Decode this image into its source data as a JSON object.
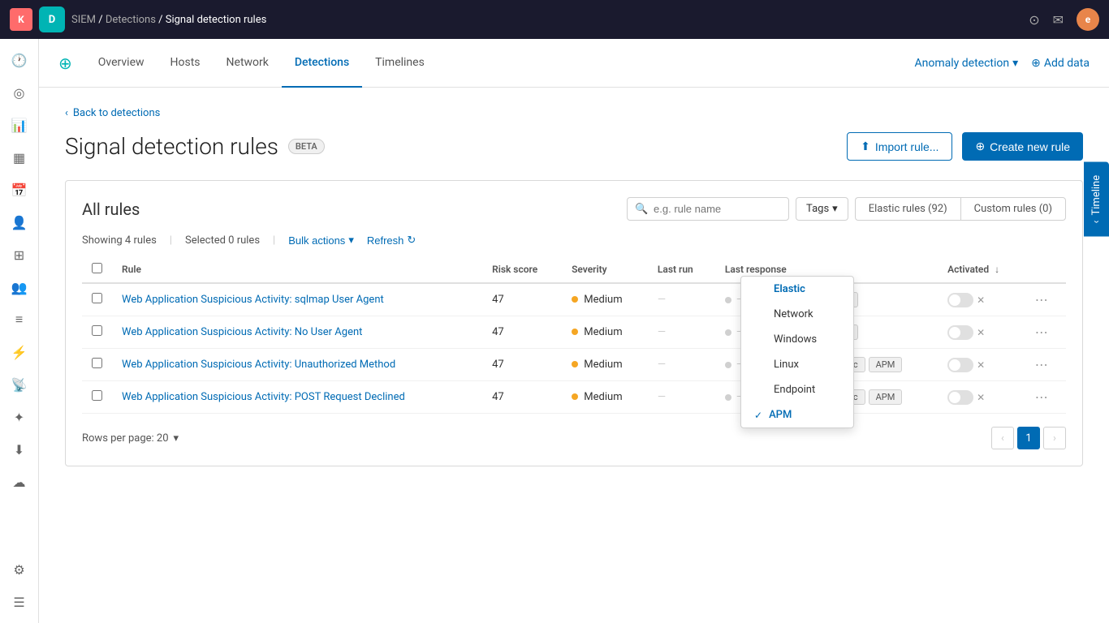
{
  "topbar": {
    "logo_letter": "K",
    "app_letter": "D",
    "breadcrumb": {
      "siem": "SIEM",
      "detections": "Detections",
      "current": "Signal detection rules"
    },
    "icons": [
      "bell-icon",
      "mail-icon"
    ],
    "avatar_letter": "e"
  },
  "nav": {
    "logo_title": "SIEM",
    "tabs": [
      {
        "label": "Overview",
        "active": false
      },
      {
        "label": "Hosts",
        "active": false
      },
      {
        "label": "Network",
        "active": false
      },
      {
        "label": "Detections",
        "active": true
      },
      {
        "label": "Timelines",
        "active": false
      }
    ],
    "anomaly_detection": "Anomaly detection",
    "add_data": "Add data"
  },
  "page": {
    "back_link": "Back to detections",
    "title": "Signal detection rules",
    "beta_badge": "BETA",
    "import_btn": "Import rule...",
    "create_btn": "Create new rule"
  },
  "card": {
    "title": "All rules",
    "search_placeholder": "e.g. rule name",
    "tags_label": "Tags",
    "elastic_rules_label": "Elastic rules (92)",
    "custom_rules_label": "Custom rules (0)",
    "showing_label": "Showing 4 rules",
    "selected_label": "Selected 0 rules",
    "bulk_actions": "Bulk actions",
    "refresh": "Refresh"
  },
  "table": {
    "headers": [
      "Rule",
      "Risk score",
      "Severity",
      "Last run",
      "Last response",
      "",
      "Activated"
    ],
    "rows": [
      {
        "name": "Web Application Suspicious Activity: sqlmap User Agent",
        "risk": "47",
        "severity": "Medium",
        "last_run": "—",
        "tags": [
          "APM"
        ],
        "activated": false
      },
      {
        "name": "Web Application Suspicious Activity: No User Agent",
        "risk": "47",
        "severity": "Medium",
        "last_run": "—",
        "tags": [
          "APM"
        ],
        "activated": false
      },
      {
        "name": "Web Application Suspicious Activity: Unauthorized Method",
        "risk": "47",
        "severity": "Medium",
        "last_run": "—",
        "tags": [
          "Elastic",
          "APM"
        ],
        "activated": false
      },
      {
        "name": "Web Application Suspicious Activity: POST Request Declined",
        "risk": "47",
        "severity": "Medium",
        "last_run": "—",
        "tags": [
          "Elastic",
          "APM"
        ],
        "activated": false
      }
    ]
  },
  "dropdown": {
    "items": [
      {
        "label": "Elastic",
        "selected": false,
        "bold": true
      },
      {
        "label": "Network",
        "selected": false
      },
      {
        "label": "Windows",
        "selected": false
      },
      {
        "label": "Linux",
        "selected": false
      },
      {
        "label": "Endpoint",
        "selected": false
      },
      {
        "label": "APM",
        "selected": true
      }
    ]
  },
  "pagination": {
    "rows_per_page": "Rows per page: 20",
    "current_page": "1"
  },
  "timeline_tab": "Timeline",
  "sidebar": {
    "icons": [
      "clock-icon",
      "circle-icon",
      "chart-icon",
      "table-icon",
      "calendar-icon",
      "person-icon",
      "grid-icon",
      "user-icon",
      "layers-icon",
      "plug-icon",
      "wifi-icon",
      "hub-icon",
      "download-icon",
      "cloud-icon",
      "settings-icon",
      "menu-icon"
    ]
  }
}
